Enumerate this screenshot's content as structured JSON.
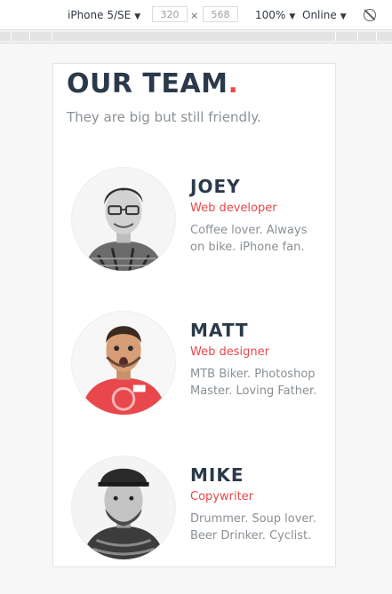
{
  "toolbar": {
    "device": "iPhone 5/SE",
    "width": "320",
    "height": "568",
    "times": "×",
    "zoom": "100%",
    "network": "Online",
    "caret": "▼"
  },
  "page": {
    "title": "OUR TEAM",
    "title_dot": ".",
    "subtitle": "They are big but still friendly.",
    "accent_color": "#e8474c",
    "heading_color": "#2b3a4a",
    "text_color": "#8a9096"
  },
  "team": [
    {
      "name": "JOEY",
      "role": "Web developer",
      "bio": "Coffee lover. Always on bike. iPhone fan."
    },
    {
      "name": "MATT",
      "role": "Web designer",
      "bio": "MTB Biker. Photoshop Master. Loving Father."
    },
    {
      "name": "MIKE",
      "role": "Copywriter",
      "bio": "Drummer. Soup lover. Beer Drinker. Cyclist."
    }
  ]
}
